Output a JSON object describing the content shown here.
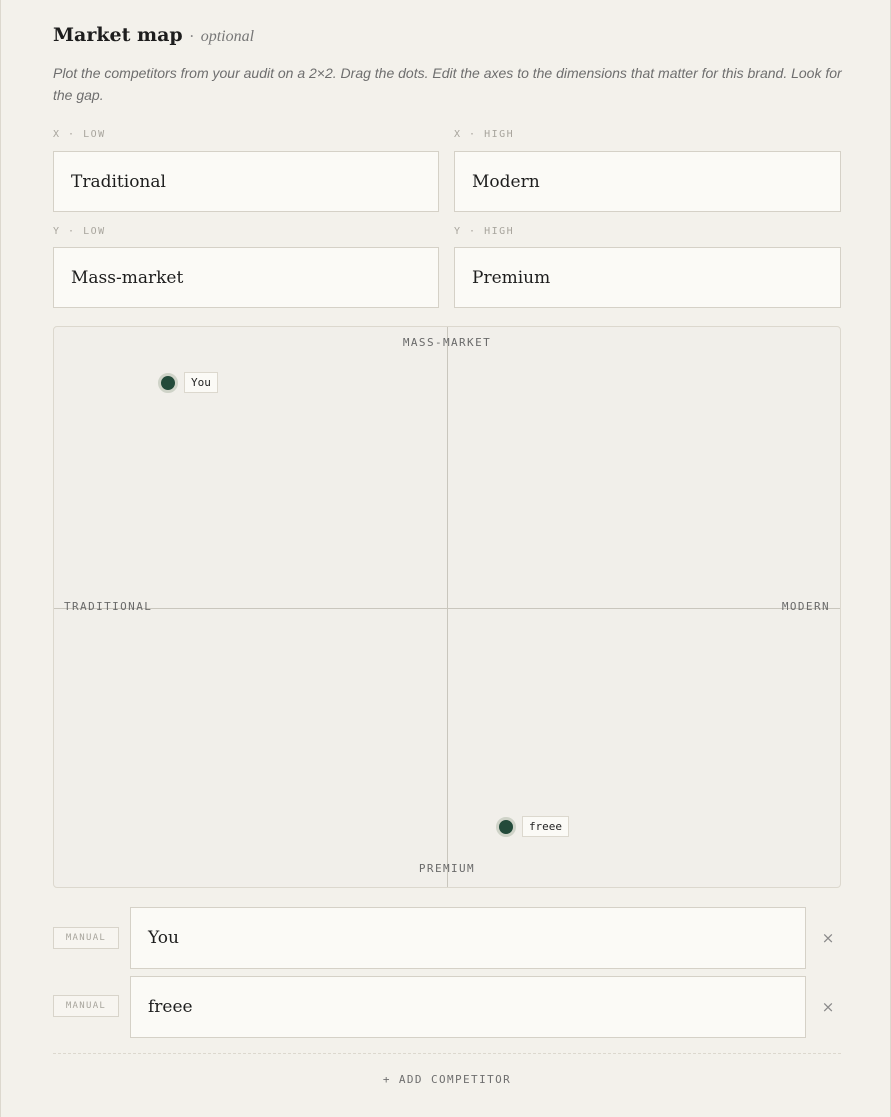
{
  "section": {
    "title": "Market map",
    "separator": "·",
    "optional_label": "optional",
    "description": "Plot the competitors from your audit on a 2×2. Drag the dots. Edit the axes to the dimensions that matter for this brand. Look for the gap."
  },
  "axes_fields": {
    "x_low": {
      "label": "X · LOW",
      "value": "Traditional"
    },
    "x_high": {
      "label": "X · HIGH",
      "value": "Modern"
    },
    "y_low": {
      "label": "Y · LOW",
      "value": "Mass-market"
    },
    "y_high": {
      "label": "Y · HIGH",
      "value": "Premium"
    }
  },
  "map": {
    "top_label": "MASS-MARKET",
    "bottom_label": "PREMIUM",
    "left_label": "TRADITIONAL",
    "right_label": "MODERN",
    "dot_color": "#234a3a",
    "points": [
      {
        "name": "You",
        "x": -0.71,
        "y": -0.8
      },
      {
        "name": "freee",
        "x": 0.15,
        "y": 0.78
      }
    ]
  },
  "competitors": [
    {
      "badge": "MANUAL",
      "name": "You",
      "remove": "×"
    },
    {
      "badge": "MANUAL",
      "name": "freee",
      "remove": "×"
    }
  ],
  "add_button": "+ ADD COMPETITOR"
}
